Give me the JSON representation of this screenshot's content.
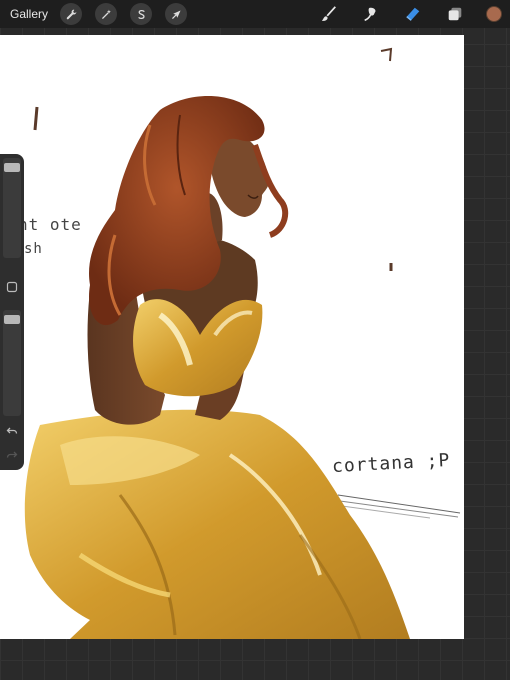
{
  "topbar": {
    "gallery_label": "Gallery",
    "left_tools": [
      {
        "name": "actions",
        "icon": "wrench-icon"
      },
      {
        "name": "adjustments",
        "icon": "magic-wand-icon"
      },
      {
        "name": "selection",
        "icon": "selection-s-icon"
      },
      {
        "name": "transform",
        "icon": "arrow-cursor-icon"
      }
    ],
    "right_tools": [
      {
        "name": "brush",
        "icon": "brush-icon"
      },
      {
        "name": "smudge",
        "icon": "smudge-icon"
      },
      {
        "name": "eraser",
        "icon": "eraser-icon",
        "active": true
      },
      {
        "name": "layers",
        "icon": "layers-icon"
      }
    ],
    "current_color": "#a86a4e"
  },
  "canvas": {
    "note_text": "cortana ;P",
    "side_scribble_line1": "nt ote",
    "side_scribble_line2": "sh"
  },
  "sidebar": {
    "brush_size_level": 0.95,
    "opacity_level": 0.95,
    "undo_icon": "undo-icon",
    "redo_icon": "redo-icon",
    "modify_button_icon": "square-icon"
  },
  "colors": {
    "accent": "#3a8ee6",
    "skin": "#6b4128",
    "hair": "#8e3d1e",
    "dress": "#d9a83a"
  }
}
